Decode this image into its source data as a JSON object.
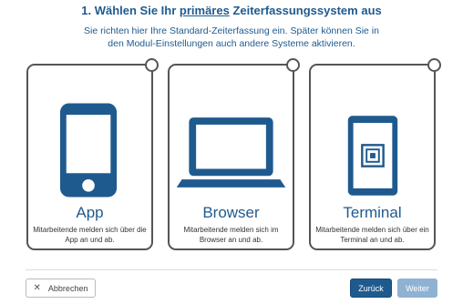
{
  "header": {
    "title_prefix": "1. Wählen Sie Ihr ",
    "title_emph": "primäres",
    "title_suffix": " Zeiterfassungssystem aus",
    "subtitle_line1": "Sie richten hier Ihre Standard-Zeiterfassung ein. Später können Sie in",
    "subtitle_line2": "den Modul-Einstellungen auch andere Systeme aktivieren."
  },
  "options": [
    {
      "icon": "smartphone-icon",
      "name": "App",
      "description": "Mitarbeitende melden sich über die App an und ab."
    },
    {
      "icon": "laptop-icon",
      "name": "Browser",
      "description": "Mitarbeitende melden sich im Browser an und ab."
    },
    {
      "icon": "terminal-icon",
      "name": "Terminal",
      "description": "Mitarbeitende melden sich über ein Terminal an und ab."
    }
  ],
  "footer": {
    "cancel_label": "Abbrechen",
    "back_label": "Zurück",
    "next_label": "Weiter"
  },
  "colors": {
    "primary": "#1f5a8f",
    "disabled": "#8fb2d3"
  }
}
